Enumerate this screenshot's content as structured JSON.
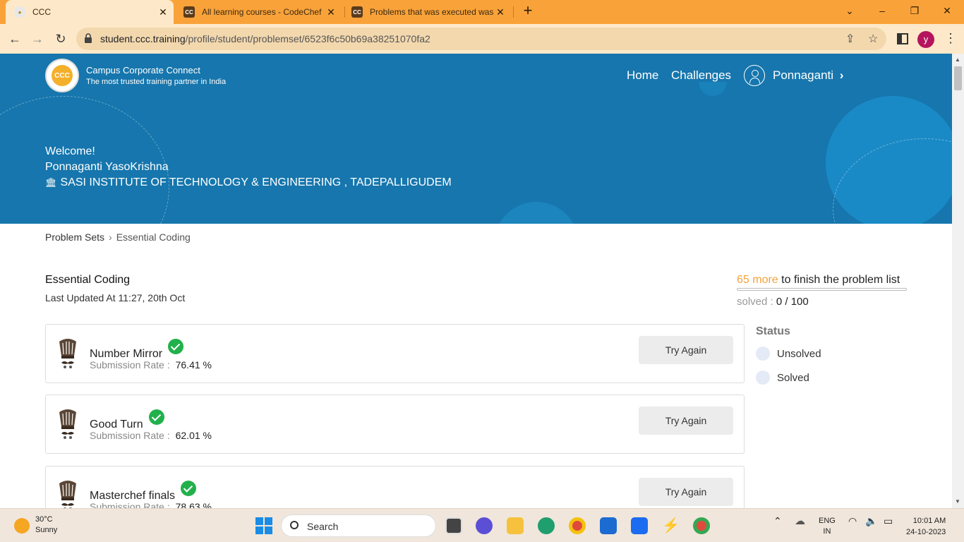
{
  "browser": {
    "tabs": [
      {
        "title": "CCC",
        "favicon": "ccc-favicon",
        "active": true
      },
      {
        "title": "All learning courses - CodeChef",
        "favicon": "codechef-favicon",
        "active": false
      },
      {
        "title": "Problems that was executed was",
        "favicon": "codechef-favicon",
        "active": false
      }
    ],
    "url_domain": "student.ccc.training",
    "url_path": "/profile/student/problemset/6523f6c50b69a38251070fa2",
    "profile_initial": "y",
    "accent": "#f9a23a"
  },
  "site": {
    "brand_name": "Campus Corporate Connect",
    "brand_tagline": "The most trusted training partner in India",
    "logo_text": "CCC",
    "nav": {
      "home": "Home",
      "challenges": "Challenges",
      "user": "Ponnaganti"
    },
    "primary_color": "#1676ad"
  },
  "hero": {
    "welcome": "Welcome!",
    "student_name": "Ponnaganti YasoKrishna",
    "institute": "SASI INSTITUTE OF TECHNOLOGY & ENGINEERING , TADEPALLIGUDEM"
  },
  "breadcrumb": {
    "root": "Problem Sets",
    "current": "Essential Coding"
  },
  "problem_set": {
    "title": "Essential Coding",
    "last_updated": "Last Updated At 11:27, 20th Oct",
    "remaining_count": "65 more",
    "remaining_text": " to finish the problem list",
    "solved_label": "solved : ",
    "solved_value": "0 / 100",
    "progress_fraction": 0.0
  },
  "problems": [
    {
      "name": "Number Mirror",
      "rate_label": "Submission Rate :",
      "rate": "76.41 %",
      "action": "Try Again"
    },
    {
      "name": "Good Turn",
      "rate_label": "Submission Rate :",
      "rate": "62.01 %",
      "action": "Try Again"
    },
    {
      "name": "Masterchef finals",
      "rate_label": "Submission Rate :",
      "rate": "78.63 %",
      "action": "Try Again"
    }
  ],
  "status_filter": {
    "heading": "Status",
    "options": [
      "Unsolved",
      "Solved"
    ]
  },
  "taskbar": {
    "weather_temp": "30°C",
    "weather_desc": "Sunny",
    "search_label": "Search",
    "lang_top": "ENG",
    "lang_bottom": "IN",
    "time": "10:01 AM",
    "date": "24-10-2023"
  }
}
